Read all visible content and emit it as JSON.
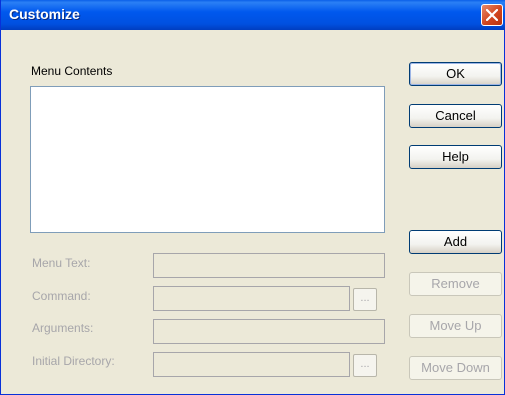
{
  "window": {
    "title": "Customize"
  },
  "menu_contents": {
    "label": "Menu Contents"
  },
  "fields": {
    "menu_text": {
      "label": "Menu Text:",
      "value": ""
    },
    "command": {
      "label": "Command:",
      "value": "",
      "browse": "..."
    },
    "arguments": {
      "label": "Arguments:",
      "value": ""
    },
    "initial_directory": {
      "label": "Initial Directory:",
      "value": "",
      "browse": "..."
    }
  },
  "buttons": {
    "ok": "OK",
    "cancel": "Cancel",
    "help": "Help",
    "add": "Add",
    "remove": "Remove",
    "move_up": "Move Up",
    "move_down": "Move Down"
  },
  "icons": {
    "close": "close-x-icon"
  }
}
